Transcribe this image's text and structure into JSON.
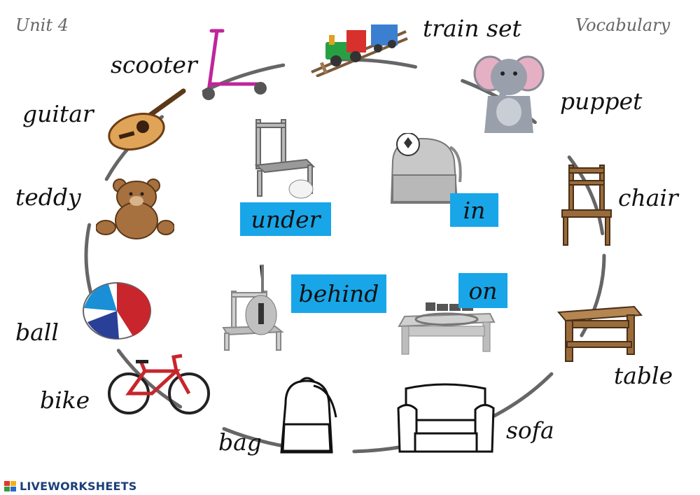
{
  "header": {
    "unit": "Unit 4",
    "topic": "Vocabulary"
  },
  "vocabulary": {
    "train_set": "train  set",
    "puppet": "puppet",
    "chair": "chair",
    "table": "table",
    "sofa": "sofa",
    "bag": "bag",
    "bike": "bike",
    "ball": "ball",
    "teddy": "teddy",
    "guitar": "guitar",
    "scooter": "scooter"
  },
  "prepositions": {
    "under": "under",
    "in": "in",
    "behind": "behind",
    "on": "on"
  },
  "footer": {
    "brand": "LIVEWORKSHEETS"
  },
  "colors": {
    "label_box": "#18a6e8",
    "circle": "#666666",
    "brand": "#1c3f7a"
  },
  "icons": [
    "train-set-icon",
    "puppet-icon",
    "chair-icon",
    "table-icon",
    "sofa-icon",
    "bag-icon",
    "bike-icon",
    "ball-icon",
    "teddy-icon",
    "guitar-icon",
    "scooter-icon",
    "chair-under-icon",
    "bag-in-icon",
    "chair-behind-icon",
    "table-on-icon",
    "liveworksheets-logo-icon"
  ]
}
